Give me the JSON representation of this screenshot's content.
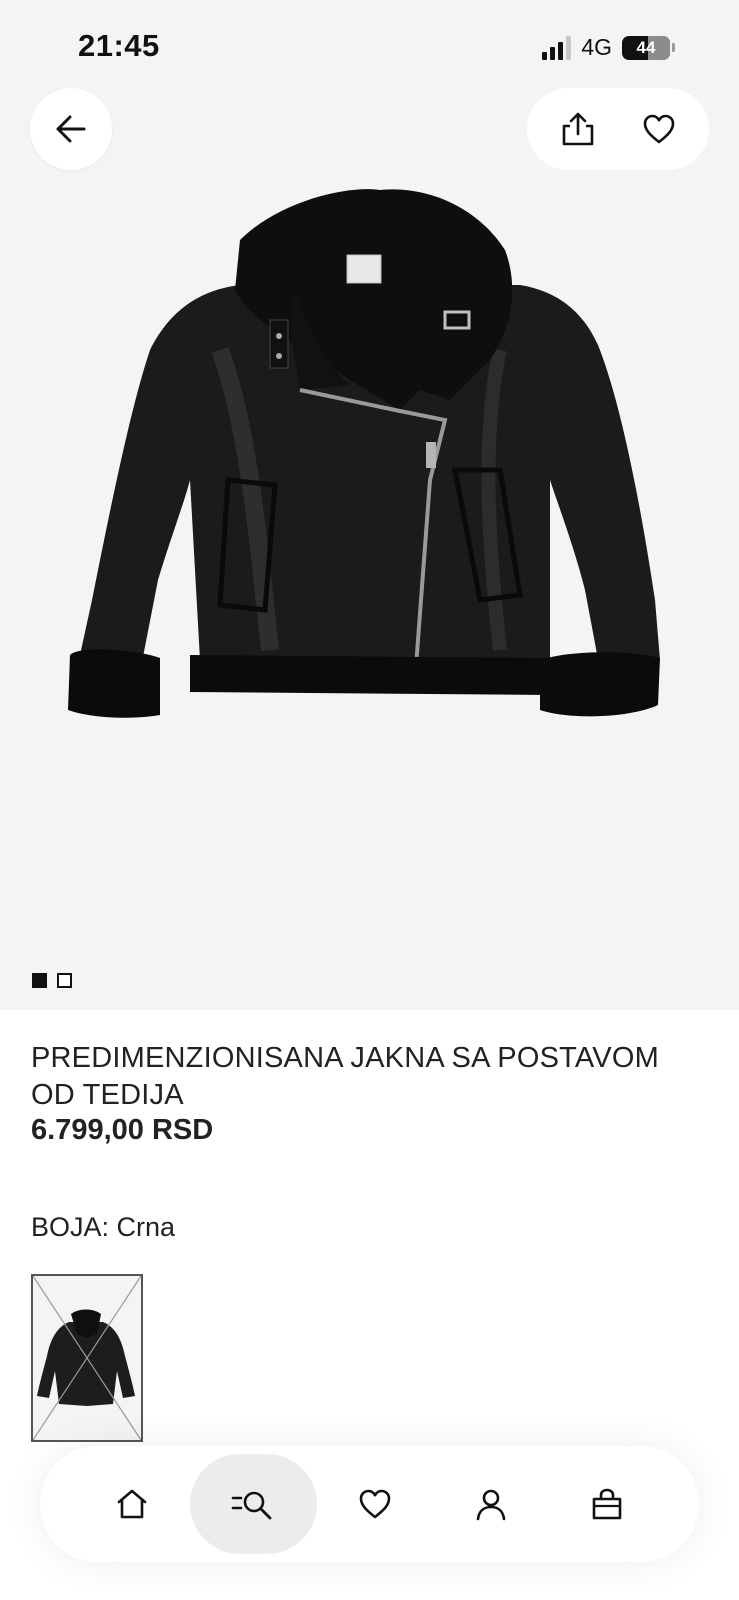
{
  "status_bar": {
    "time": "21:45",
    "network": "4G",
    "battery": "44"
  },
  "top_actions": {
    "back_icon": "arrow-left-icon",
    "share_icon": "share-icon",
    "favorite_icon": "heart-icon"
  },
  "gallery": {
    "image_description_icon": "jacket-image",
    "pages": 2,
    "active_page": 1
  },
  "product": {
    "title": "PREDIMENZIONISANA JAKNA SA POSTAVOM OD TEDIJA",
    "price": "6.799,00 RSD",
    "color_label": "BOJA: Crna"
  },
  "bottom_nav": {
    "items": [
      {
        "icon": "home-icon",
        "active": false
      },
      {
        "icon": "search-icon",
        "active": true
      },
      {
        "icon": "heart-icon",
        "active": false
      },
      {
        "icon": "user-icon",
        "active": false
      },
      {
        "icon": "bag-icon",
        "active": false
      }
    ]
  },
  "colors": {
    "hero_bg": "#f4f4f4",
    "text": "#222222",
    "nav_active": "#ececec"
  }
}
